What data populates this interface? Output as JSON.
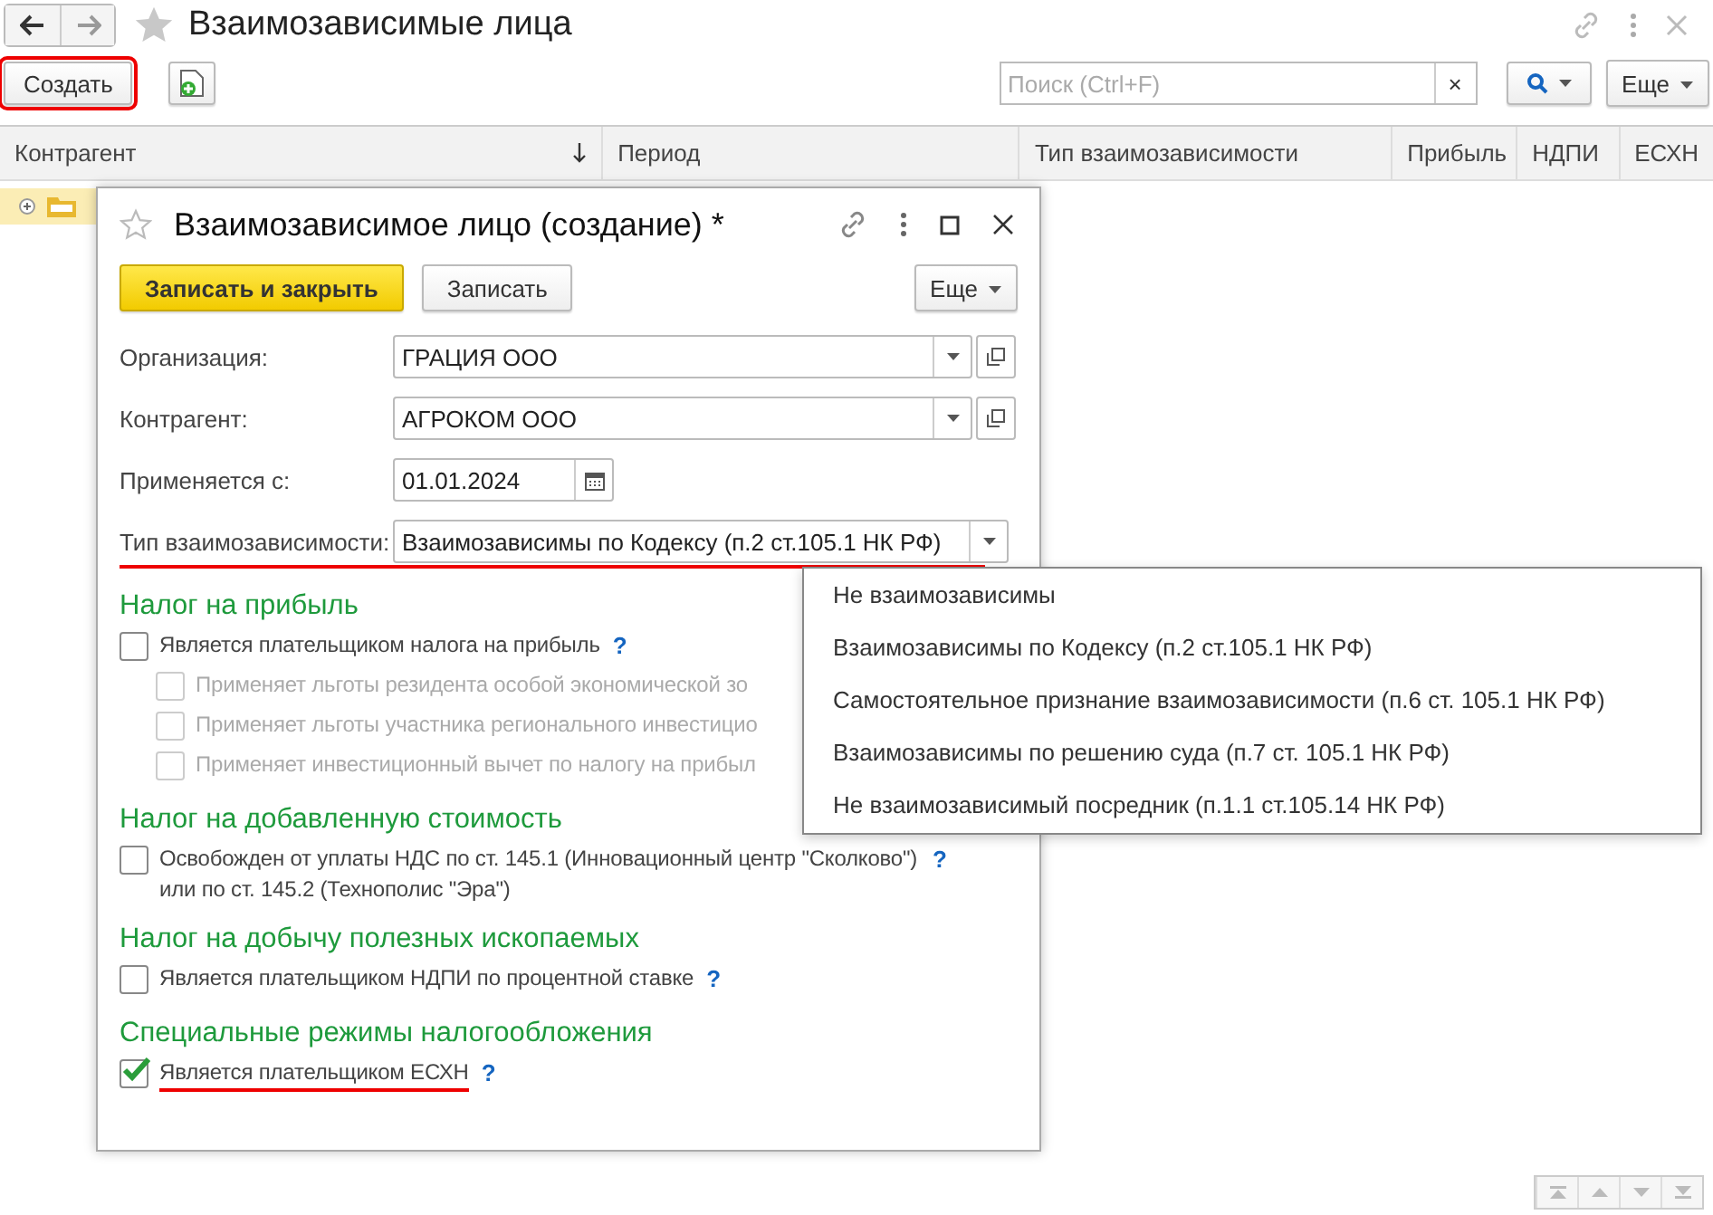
{
  "window": {
    "title": "Взаимозависимые лица"
  },
  "toolbar": {
    "create_button": {
      "label": "Создать",
      "highlighted": true
    },
    "search": {
      "placeholder": "Поиск (Ctrl+F)"
    },
    "clear": "×",
    "more_button": "Еще"
  },
  "table": {
    "columns": [
      {
        "label": "Контрагент",
        "sorted": true
      },
      {
        "label": "Период",
        "sorted": false
      },
      {
        "label": "Тип взаимозависимости",
        "sorted": false
      },
      {
        "label": "Прибыль",
        "sorted": false
      },
      {
        "label": "НДПИ",
        "sorted": false
      },
      {
        "label": "ЕСХН",
        "sorted": false
      }
    ],
    "rows": [
      {
        "selected": true
      }
    ]
  },
  "dialog": {
    "title": "Взаимозависимое лицо (создание) *",
    "buttons": {
      "save_close": "Записать и закрыть",
      "save": "Записать",
      "more": "Еще"
    },
    "fields": [
      {
        "kind": "select",
        "label": "Организация:",
        "value": "ГРАЦИЯ ООО",
        "highlighted": false
      },
      {
        "kind": "select",
        "label": "Контрагент:",
        "value": "АГРОКОМ ООО",
        "highlighted": false
      },
      {
        "kind": "date",
        "label": "Применяется с:",
        "value": "01.01.2024",
        "highlighted": false
      },
      {
        "kind": "choice",
        "label": "Тип взаимозависимости:",
        "value": "Взаимозависимы по Кодексу (п.2 ст.105.1 НК РФ)",
        "highlighted": true
      }
    ],
    "sections": [
      {
        "title": "Налог на прибыль",
        "options": [
          {
            "label": "Является плательщиком налога на прибыль",
            "checked": false,
            "disabled": false,
            "help": "?",
            "indented": false,
            "highlighted": false
          },
          {
            "label": "Применяет льготы резидента особой экономической зо",
            "checked": false,
            "disabled": true,
            "indented": true,
            "highlighted": false
          },
          {
            "label": "Применяет льготы участника регионального инвестицио",
            "checked": false,
            "disabled": true,
            "indented": true,
            "highlighted": false
          },
          {
            "label": "Применяет инвестиционный вычет по налогу на прибыл",
            "checked": false,
            "disabled": true,
            "indented": true,
            "highlighted": false
          }
        ]
      },
      {
        "title": "Налог на добавленную стоимость",
        "options": [
          {
            "label": "Освобожден от уплаты НДС по ст. 145.1 (Инновационный центр \"Сколково\") или по ст. 145.2 (Технополис \"Эра\")",
            "checked": false,
            "disabled": false,
            "help": "?",
            "indented": false,
            "highlighted": false
          }
        ]
      },
      {
        "title": "Налог на добычу полезных ископаемых",
        "options": [
          {
            "label": "Является плательщиком НДПИ по процентной ставке",
            "checked": false,
            "disabled": false,
            "help": "?",
            "indented": false,
            "highlighted": false
          }
        ]
      },
      {
        "title": "Специальные режимы налогообложения",
        "options": [
          {
            "label": "Является плательщиком ЕСХН",
            "checked": true,
            "disabled": false,
            "help": "?",
            "indented": false,
            "highlighted": true
          }
        ]
      }
    ]
  },
  "dropdown": {
    "items": [
      "Не взаимозависимы",
      "Взаимозависимы по Кодексу (п.2 ст.105.1 НК РФ)",
      "Самостоятельное признание взаимозависимости (п.6 ст. 105.1 НК РФ)",
      "Взаимозависимы по решению суда (п.7 ст. 105.1 НК РФ)",
      "Не взаимозависимый посредник (п.1.1 ст.105.14 НК РФ)"
    ]
  }
}
